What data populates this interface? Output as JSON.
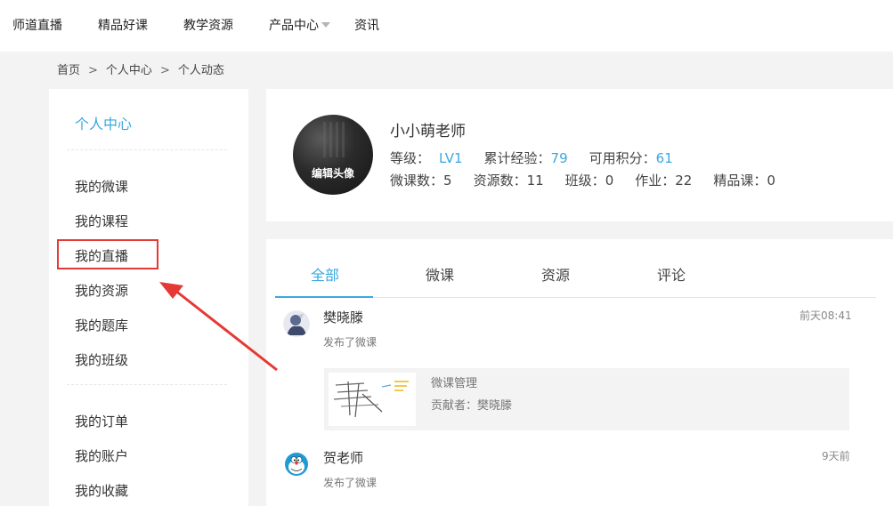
{
  "topnav": {
    "items": [
      "师道直播",
      "精品好课",
      "教学资源",
      "产品中心",
      "资讯"
    ]
  },
  "breadcrumb": {
    "home": "首页",
    "sep": ">",
    "level1": "个人中心",
    "level2": "个人动态"
  },
  "sidebar": {
    "title": "个人中心",
    "group1": [
      "我的微课",
      "我的课程",
      "我的直播",
      "我的资源",
      "我的题库",
      "我的班级"
    ],
    "group2": [
      "我的订单",
      "我的账户",
      "我的收藏"
    ]
  },
  "profile": {
    "edit_avatar": "编辑头像",
    "name": "小小萌老师",
    "level_label": "等级：",
    "level": "LV1",
    "exp_label": "累计经验：",
    "exp": "79",
    "points_label": "可用积分：",
    "points": "61",
    "microcourse_label": "微课数：",
    "microcourse": "5",
    "resource_label": "资源数：",
    "resource": "11",
    "class_label": "班级：",
    "class": "0",
    "homework_label": "作业：",
    "homework": "22",
    "premium_label": "精品课：",
    "premium": "0"
  },
  "tabs": [
    "全部",
    "微课",
    "资源",
    "评论"
  ],
  "feed": [
    {
      "user": "樊晓滕",
      "time": "前天08:41",
      "action": "发布了微课",
      "card": {
        "title": "微课管理",
        "author": "贡献者：樊晓滕"
      }
    },
    {
      "user": "贺老师",
      "time": "9天前",
      "action": "发布了微课"
    }
  ],
  "colors": {
    "accent": "#3aa8e0",
    "highlight": "#e53935",
    "background": "#f3f3f3"
  }
}
